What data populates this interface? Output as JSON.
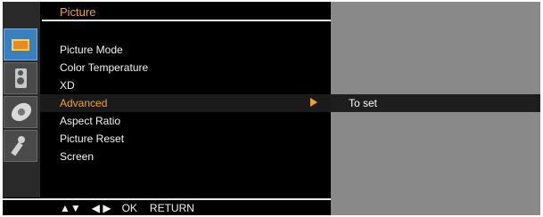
{
  "menu": {
    "title": "Picture",
    "icons": [
      {
        "name": "picture-icon",
        "active": true
      },
      {
        "name": "sound-icon",
        "active": false
      },
      {
        "name": "channel-icon",
        "active": false
      },
      {
        "name": "setup-icon",
        "active": false
      }
    ],
    "items": [
      {
        "label": "Picture Mode"
      },
      {
        "label": "Color Temperature"
      },
      {
        "label": "XD"
      },
      {
        "label": "Advanced",
        "selected": true,
        "has_submenu": true
      },
      {
        "label": "Aspect Ratio"
      },
      {
        "label": "Picture Reset"
      },
      {
        "label": "Screen"
      }
    ]
  },
  "help_text": "To set",
  "nav": {
    "up_down": "▲▼",
    "left_right": "◀ ▶",
    "ok": "OK",
    "return": "RETURN"
  },
  "colors": {
    "accent": "#f0a030",
    "panel": "#898989",
    "background": "#000000"
  }
}
